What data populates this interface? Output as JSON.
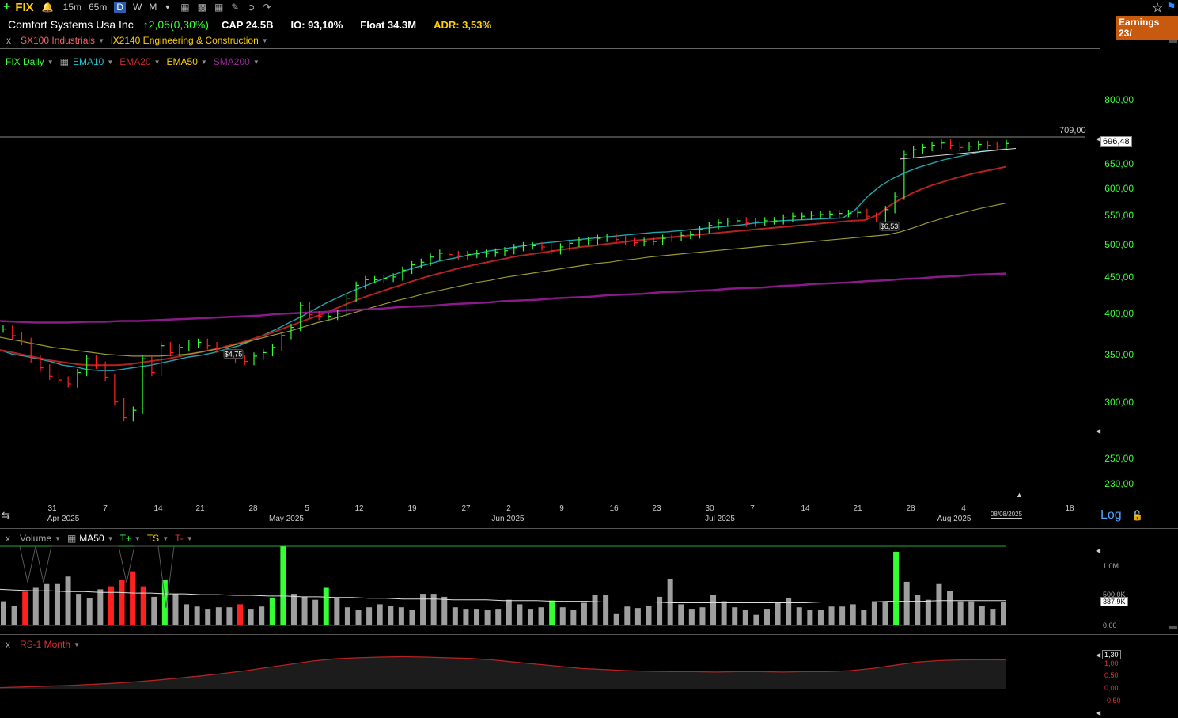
{
  "toolbar": {
    "symbol": "FIX",
    "timeframes": [
      "15m",
      "65m",
      "D",
      "W",
      "M"
    ],
    "active_timeframe": "D",
    "earnings_badge": "Earnings 23/"
  },
  "header": {
    "company": "Comfort Systems Usa Inc",
    "change": "2,05(0,30%)",
    "cap": "CAP 24.5B",
    "io": "IO: 93,10%",
    "float": "Float 34.3M",
    "adr": "ADR: 3,53%"
  },
  "groups": {
    "close": "x",
    "sector": "SX100 Industrials",
    "industry": "iX2140 Engineering & Construction"
  },
  "legend": {
    "main": "FIX Daily",
    "ema10": "EMA10",
    "ema20": "EMA20",
    "ema50": "EMA50",
    "sma200": "SMA200"
  },
  "colors": {
    "up": "#33ff33",
    "down": "#ff2020",
    "ema10": "#1fa5b0",
    "ema20": "#b22222",
    "ema50": "#9a9a2a",
    "sma200": "#8a1a8a",
    "volume_neutral": "#9e9e9e"
  },
  "price_axis": {
    "labels": [
      "800,00",
      "650,00",
      "600,00",
      "550,00",
      "500,00",
      "450,00",
      "400,00",
      "350,00",
      "300,00",
      "250,00",
      "230,00"
    ],
    "last_price": "696,48",
    "resistance_label": "709,00",
    "scale": "Log"
  },
  "x_axis": {
    "days": [
      "31",
      "7",
      "14",
      "21",
      "28",
      "5",
      "12",
      "19",
      "27",
      "2",
      "9",
      "16",
      "23",
      "30",
      "7",
      "14",
      "21",
      "28",
      "4",
      "18"
    ],
    "months": [
      "Apr 2025",
      "May 2025",
      "Jun 2025",
      "Jul 2025",
      "Aug 2025"
    ],
    "last_date": "08/08/2025"
  },
  "annotations": {
    "earnings1": "$4,75",
    "earnings2": "$6,53"
  },
  "volume_panel": {
    "close": "x",
    "title": "Volume",
    "ma": "MA50",
    "tplus": "T+",
    "ts": "TS",
    "tminus": "T-",
    "labels": [
      "1.0M",
      "500.0K",
      "0,00"
    ],
    "current": "387.9K"
  },
  "rs_panel": {
    "close": "x",
    "title": "RS-1 Month",
    "current": "1,30",
    "labels": [
      "1,00",
      "0,50",
      "0,00",
      "-0,50"
    ]
  },
  "chart_data": {
    "type": "line",
    "y_scale": "log",
    "ylim": [
      220,
      830
    ],
    "resistance": 709,
    "series": [
      {
        "name": "FIX Daily",
        "values": [
          380,
          372,
          365,
          345,
          335,
          326,
          322,
          318,
          330,
          345,
          338,
          325,
          300,
          285,
          292,
          345,
          330,
          360,
          352,
          358,
          362,
          364,
          360,
          356,
          352,
          345,
          342,
          348,
          352,
          358,
          372,
          382,
          410,
          398,
          396,
          396,
          400,
          420,
          438,
          446,
          446,
          448,
          450,
          460,
          468,
          472,
          480,
          486,
          484,
          482,
          484,
          485,
          486,
          488,
          490,
          495,
          498,
          498,
          496,
          490,
          496,
          502,
          506,
          506,
          510,
          512,
          508,
          505,
          503,
          505,
          505,
          510,
          512,
          515,
          516,
          525,
          532,
          536,
          538,
          540,
          536,
          538,
          540,
          540,
          545,
          548,
          548,
          550,
          551,
          552,
          553,
          553,
          555,
          548,
          545,
          560,
          585,
          670,
          680,
          685,
          690,
          695,
          690,
          685,
          688,
          692,
          690,
          688,
          694
        ]
      },
      {
        "name": "EMA10",
        "values": [
          355,
          350,
          348,
          345,
          342,
          338,
          336,
          333,
          332,
          332,
          334,
          336,
          338,
          341,
          344,
          347,
          349,
          352,
          356,
          360,
          366,
          373,
          380,
          388,
          396,
          405,
          414,
          422,
          430,
          437,
          444,
          451,
          458,
          464,
          469,
          474,
          478,
          482,
          486,
          490,
          493,
          496,
          499,
          502,
          504,
          506,
          508,
          510,
          512,
          514,
          516,
          518,
          520,
          521,
          523,
          525,
          527,
          529,
          531,
          533,
          536,
          538,
          540,
          541,
          542,
          543,
          544,
          545,
          560,
          585,
          605,
          620,
          632,
          642,
          650,
          658,
          664,
          670,
          676,
          679,
          682
        ]
      },
      {
        "name": "EMA20",
        "values": [
          355,
          352,
          349,
          346,
          343,
          341,
          339,
          338,
          338,
          338,
          339,
          341,
          343,
          345,
          348,
          351,
          354,
          357,
          361,
          365,
          370,
          375,
          381,
          387,
          393,
          399,
          406,
          413,
          420,
          426,
          432,
          438,
          444,
          450,
          455,
          460,
          465,
          469,
          473,
          477,
          481,
          484,
          487,
          490,
          493,
          496,
          498,
          501,
          503,
          506,
          508,
          510,
          512,
          514,
          516,
          518,
          520,
          522,
          524,
          526,
          528,
          530,
          532,
          534,
          536,
          538,
          540,
          541,
          550,
          568,
          582,
          594,
          604,
          612,
          620,
          627,
          633,
          638,
          644
        ]
      },
      {
        "name": "EMA50",
        "values": [
          370,
          367,
          364,
          361,
          358,
          356,
          354,
          352,
          350,
          349,
          348,
          348,
          348,
          349,
          350,
          352,
          355,
          358,
          362,
          366,
          370,
          374,
          378,
          383,
          388,
          392,
          397,
          402,
          407,
          412,
          417,
          421,
          426,
          430,
          434,
          438,
          442,
          445,
          449,
          452,
          455,
          458,
          461,
          464,
          467,
          470,
          472,
          475,
          477,
          480,
          482,
          484,
          486,
          488,
          490,
          492,
          494,
          496,
          498,
          500,
          502,
          504,
          506,
          508,
          510,
          512,
          514,
          516,
          521,
          528,
          536,
          543,
          550,
          556,
          562,
          567,
          572
        ]
      },
      {
        "name": "SMA200",
        "values": [
          390,
          389,
          388,
          388,
          388,
          389,
          389,
          390,
          390,
          391,
          392,
          393,
          394,
          395,
          396,
          397,
          399,
          400,
          401,
          402,
          404,
          405,
          406,
          408,
          409,
          410,
          412,
          413,
          414,
          416,
          417,
          418,
          420,
          421,
          422,
          424,
          425,
          426,
          428,
          429,
          430,
          431,
          433,
          434,
          435,
          437,
          438,
          440,
          441,
          442,
          444,
          445,
          447,
          448,
          450,
          451,
          453,
          454,
          455
        ]
      }
    ],
    "volume_bars": [
      {
        "v": 0.32,
        "c": "n"
      },
      {
        "v": 0.26,
        "c": "n"
      },
      {
        "v": 0.45,
        "c": "r"
      },
      {
        "v": 0.5,
        "c": "n"
      },
      {
        "v": 0.55,
        "c": "n"
      },
      {
        "v": 0.55,
        "c": "n"
      },
      {
        "v": 0.65,
        "c": "n"
      },
      {
        "v": 0.42,
        "c": "n"
      },
      {
        "v": 0.36,
        "c": "n"
      },
      {
        "v": 0.48,
        "c": "n"
      },
      {
        "v": 0.52,
        "c": "r"
      },
      {
        "v": 0.6,
        "c": "r"
      },
      {
        "v": 0.72,
        "c": "r"
      },
      {
        "v": 0.52,
        "c": "r"
      },
      {
        "v": 0.38,
        "c": "n"
      },
      {
        "v": 0.6,
        "c": "g"
      },
      {
        "v": 0.42,
        "c": "n"
      },
      {
        "v": 0.28,
        "c": "n"
      },
      {
        "v": 0.25,
        "c": "n"
      },
      {
        "v": 0.22,
        "c": "n"
      },
      {
        "v": 0.24,
        "c": "n"
      },
      {
        "v": 0.24,
        "c": "n"
      },
      {
        "v": 0.28,
        "c": "r"
      },
      {
        "v": 0.22,
        "c": "n"
      },
      {
        "v": 0.25,
        "c": "n"
      },
      {
        "v": 0.37,
        "c": "g"
      },
      {
        "v": 1.05,
        "c": "g"
      },
      {
        "v": 0.42,
        "c": "n"
      },
      {
        "v": 0.38,
        "c": "n"
      },
      {
        "v": 0.34,
        "c": "n"
      },
      {
        "v": 0.5,
        "c": "g"
      },
      {
        "v": 0.36,
        "c": "n"
      },
      {
        "v": 0.24,
        "c": "n"
      },
      {
        "v": 0.2,
        "c": "n"
      },
      {
        "v": 0.24,
        "c": "n"
      },
      {
        "v": 0.28,
        "c": "n"
      },
      {
        "v": 0.26,
        "c": "n"
      },
      {
        "v": 0.24,
        "c": "n"
      },
      {
        "v": 0.2,
        "c": "n"
      },
      {
        "v": 0.42,
        "c": "n"
      },
      {
        "v": 0.42,
        "c": "n"
      },
      {
        "v": 0.38,
        "c": "n"
      },
      {
        "v": 0.24,
        "c": "n"
      },
      {
        "v": 0.22,
        "c": "n"
      },
      {
        "v": 0.22,
        "c": "n"
      },
      {
        "v": 0.2,
        "c": "n"
      },
      {
        "v": 0.22,
        "c": "n"
      },
      {
        "v": 0.34,
        "c": "n"
      },
      {
        "v": 0.28,
        "c": "n"
      },
      {
        "v": 0.22,
        "c": "n"
      },
      {
        "v": 0.24,
        "c": "n"
      },
      {
        "v": 0.33,
        "c": "g"
      },
      {
        "v": 0.24,
        "c": "n"
      },
      {
        "v": 0.2,
        "c": "n"
      },
      {
        "v": 0.3,
        "c": "n"
      },
      {
        "v": 0.4,
        "c": "n"
      },
      {
        "v": 0.4,
        "c": "n"
      },
      {
        "v": 0.16,
        "c": "n"
      },
      {
        "v": 0.25,
        "c": "n"
      },
      {
        "v": 0.23,
        "c": "n"
      },
      {
        "v": 0.26,
        "c": "n"
      },
      {
        "v": 0.38,
        "c": "n"
      },
      {
        "v": 0.62,
        "c": "n"
      },
      {
        "v": 0.28,
        "c": "n"
      },
      {
        "v": 0.22,
        "c": "n"
      },
      {
        "v": 0.24,
        "c": "n"
      },
      {
        "v": 0.4,
        "c": "n"
      },
      {
        "v": 0.32,
        "c": "n"
      },
      {
        "v": 0.24,
        "c": "n"
      },
      {
        "v": 0.2,
        "c": "n"
      },
      {
        "v": 0.14,
        "c": "n"
      },
      {
        "v": 0.22,
        "c": "n"
      },
      {
        "v": 0.3,
        "c": "n"
      },
      {
        "v": 0.36,
        "c": "n"
      },
      {
        "v": 0.24,
        "c": "n"
      },
      {
        "v": 0.2,
        "c": "n"
      },
      {
        "v": 0.2,
        "c": "n"
      },
      {
        "v": 0.25,
        "c": "n"
      },
      {
        "v": 0.25,
        "c": "n"
      },
      {
        "v": 0.28,
        "c": "n"
      },
      {
        "v": 0.2,
        "c": "n"
      },
      {
        "v": 0.32,
        "c": "n"
      },
      {
        "v": 0.32,
        "c": "n"
      },
      {
        "v": 0.98,
        "c": "g"
      },
      {
        "v": 0.58,
        "c": "n"
      },
      {
        "v": 0.4,
        "c": "n"
      },
      {
        "v": 0.34,
        "c": "n"
      },
      {
        "v": 0.55,
        "c": "n"
      },
      {
        "v": 0.46,
        "c": "n"
      },
      {
        "v": 0.32,
        "c": "n"
      },
      {
        "v": 0.32,
        "c": "n"
      },
      {
        "v": 0.26,
        "c": "n"
      },
      {
        "v": 0.22,
        "c": "n"
      },
      {
        "v": 0.31,
        "c": "n"
      }
    ],
    "volume_ma": [
      0.48,
      0.47,
      0.46,
      0.46,
      0.45,
      0.45,
      0.44,
      0.44,
      0.43,
      0.43,
      0.42,
      0.42,
      0.41,
      0.41,
      0.4,
      0.4,
      0.39,
      0.39,
      0.38,
      0.38,
      0.37,
      0.37,
      0.36,
      0.36,
      0.35,
      0.35,
      0.35,
      0.34,
      0.34,
      0.34,
      0.33,
      0.33,
      0.33,
      0.32,
      0.32,
      0.32,
      0.31,
      0.31,
      0.31,
      0.31,
      0.3,
      0.3,
      0.3,
      0.3,
      0.3,
      0.3,
      0.3,
      0.3,
      0.3,
      0.31,
      0.31,
      0.31,
      0.31,
      0.32,
      0.32,
      0.32,
      0.33,
      0.33,
      0.33,
      0.33,
      0.33
    ],
    "rs_values": [
      0.05,
      0.08,
      0.12,
      0.15,
      0.2,
      0.25,
      0.32,
      0.4,
      0.5,
      0.6,
      0.72,
      0.85,
      1.0,
      1.15,
      1.3,
      1.4,
      1.45,
      1.48,
      1.5,
      1.48,
      1.45,
      1.42,
      1.35,
      1.25,
      1.15,
      1.05,
      0.95,
      0.9,
      0.85,
      0.82,
      0.8,
      0.8,
      0.78,
      0.8,
      0.8,
      0.78,
      0.8,
      0.8,
      0.85,
      0.95,
      1.1,
      1.25,
      1.32,
      1.35,
      1.36,
      1.35
    ]
  }
}
